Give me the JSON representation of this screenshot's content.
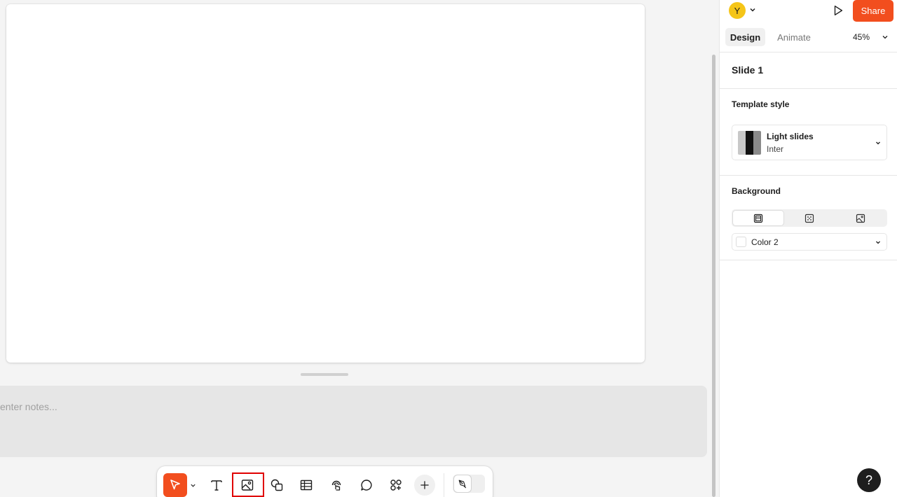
{
  "notes": {
    "placeholder": "enter notes..."
  },
  "header": {
    "avatar_initial": "Y",
    "share_label": "Share",
    "tabs": [
      {
        "label": "Design",
        "active": true
      },
      {
        "label": "Animate",
        "active": false
      }
    ],
    "zoom": "45%"
  },
  "panel": {
    "slide_title": "Slide 1",
    "template_style": {
      "heading": "Template style",
      "name": "Light slides",
      "font": "Inter"
    },
    "background": {
      "heading": "Background",
      "types": [
        "solid-icon",
        "pattern-icon",
        "image-icon"
      ],
      "color_label": "Color 2",
      "color_value": "#ffffff"
    },
    "help_label": "?"
  },
  "toolbar": {
    "tools": [
      "move-icon",
      "text-icon",
      "image-icon",
      "shapes-icon",
      "table-icon",
      "stamp-icon",
      "comment-icon",
      "widgets-icon",
      "add-icon",
      "draw-icon"
    ],
    "highlighted_tool": "image-icon"
  },
  "colors": {
    "accent": "#f24e1e",
    "highlight": "#e00000",
    "avatar": "#f5c518"
  }
}
